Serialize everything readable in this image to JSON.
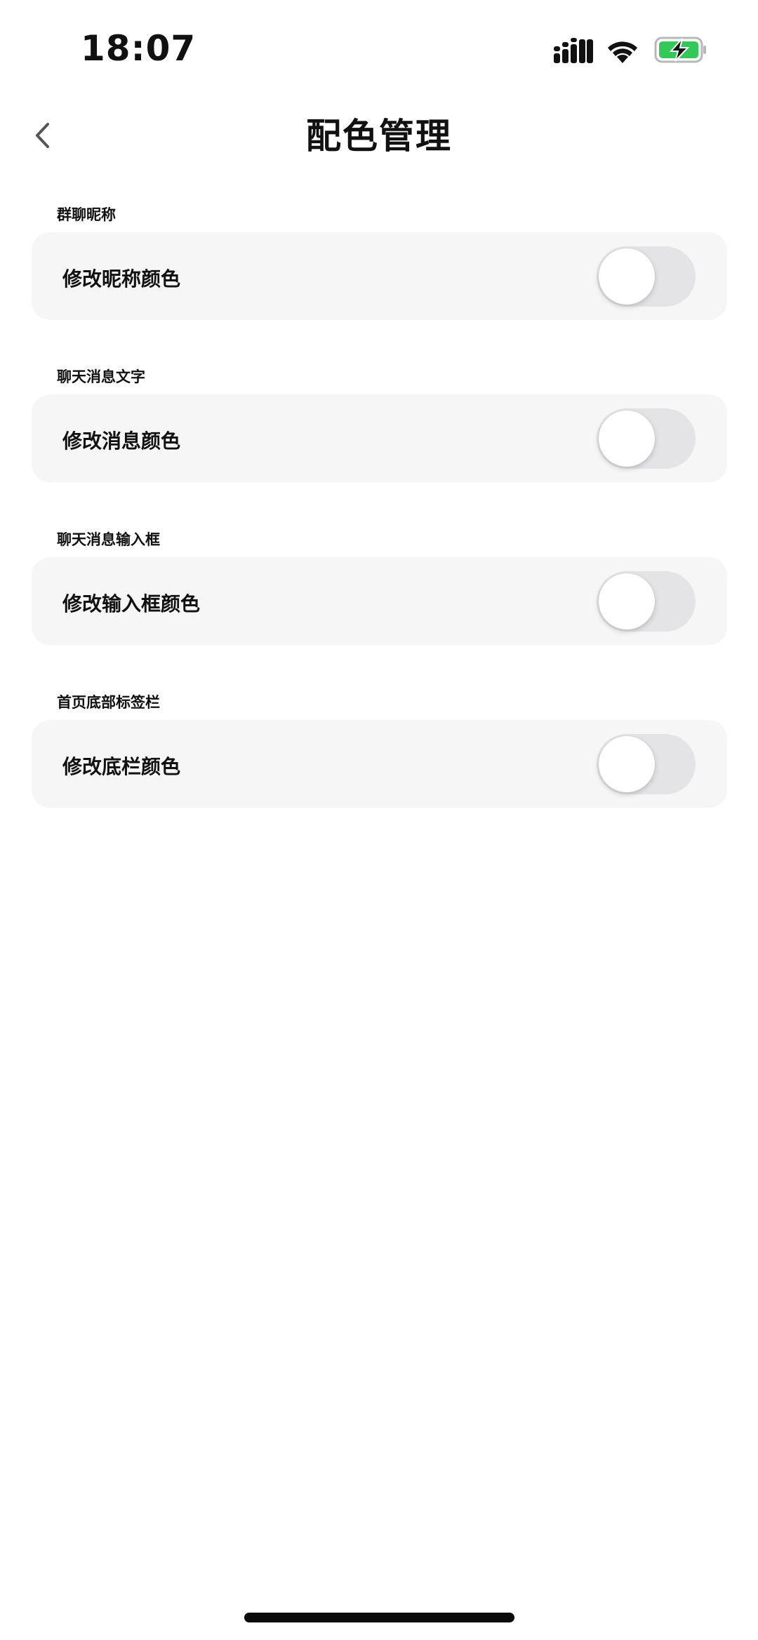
{
  "status_bar": {
    "time": "18:07",
    "icons": [
      "cellular-signal-icon",
      "wifi-icon",
      "battery-charging-icon"
    ],
    "battery_color": "#34c759"
  },
  "nav": {
    "back_icon": "chevron-left-icon",
    "title": "配色管理"
  },
  "sections": [
    {
      "header": "群聊昵称",
      "label": "修改昵称颜色",
      "enabled": false
    },
    {
      "header": "聊天消息文字",
      "label": "修改消息颜色",
      "enabled": false
    },
    {
      "header": "聊天消息输入框",
      "label": "修改输入框颜色",
      "enabled": false
    },
    {
      "header": "首页底部标签栏",
      "label": "修改底栏颜色",
      "enabled": false
    }
  ],
  "colors": {
    "card_background": "#f6f6f6",
    "toggle_off": "#e4e4e6",
    "toggle_knob": "#ffffff"
  }
}
